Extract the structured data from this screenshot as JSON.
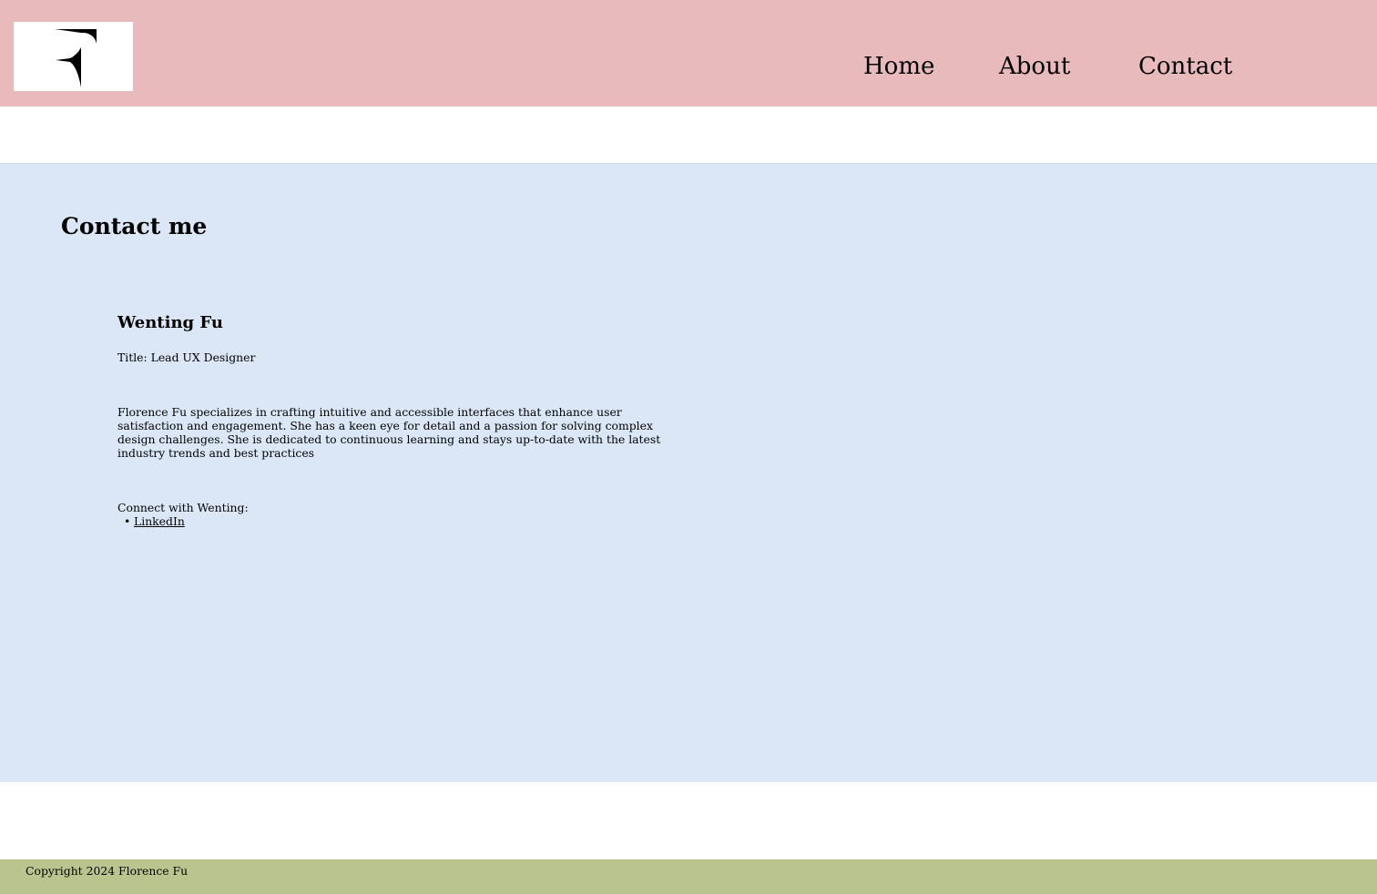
{
  "header": {
    "logo_alt": "F",
    "nav": [
      {
        "label": "Home"
      },
      {
        "label": "About"
      },
      {
        "label": "Contact"
      }
    ]
  },
  "main": {
    "title": "Contact me",
    "person": {
      "name": "Wenting Fu",
      "title": "Title: Lead UX Designer",
      "bio": "Florence Fu specializes in crafting intuitive and accessible interfaces that enhance user satisfaction and engagement. She has a keen eye for detail and a passion for solving complex design challenges. She is dedicated to continuous learning and stays up-to-date with the latest industry trends and best practices",
      "connect_label": "Connect with Wenting:",
      "links": [
        {
          "label": "LinkedIn",
          "bullet": "•"
        }
      ]
    }
  },
  "footer": {
    "copyright": "Copyright 2024 Florence Fu"
  },
  "colors": {
    "header_bg": "#e8babc",
    "main_bg": "#dbe7f7",
    "footer_bg": "#b9c48e"
  }
}
